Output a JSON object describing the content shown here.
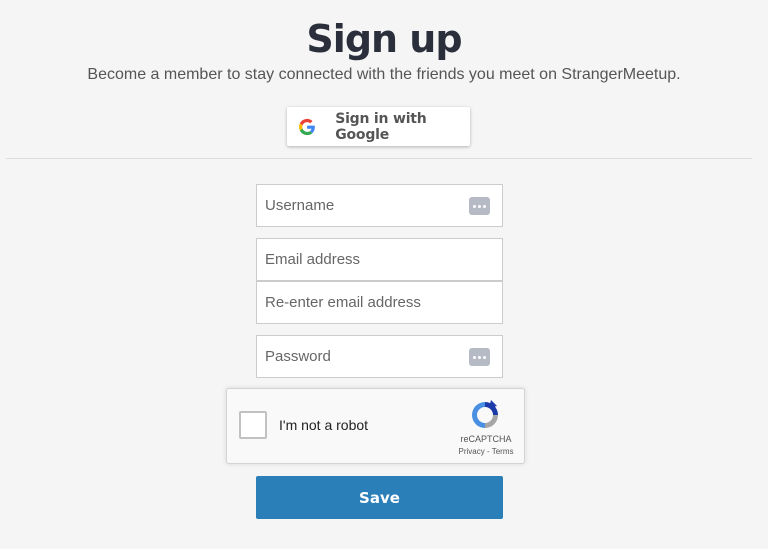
{
  "header": {
    "title": "Sign up",
    "subtitle": "Become a member to stay connected with the friends you meet on StrangerMeetup."
  },
  "google": {
    "label": "Sign in with Google",
    "icon": "google-g-icon"
  },
  "form": {
    "username": {
      "placeholder": "Username",
      "value": ""
    },
    "email": {
      "placeholder": "Email address",
      "value": ""
    },
    "email_confirm": {
      "placeholder": "Re-enter email address",
      "value": ""
    },
    "password": {
      "placeholder": "Password",
      "value": ""
    },
    "password_manager_icon": "password-manager-icon"
  },
  "recaptcha": {
    "label": "I'm not a robot",
    "brand": "reCAPTCHA",
    "privacy": "Privacy",
    "separator": " - ",
    "terms": "Terms",
    "checked": false
  },
  "save_button": {
    "label": "Save"
  },
  "colors": {
    "primary": "#2a7fb8",
    "title": "#2a2f3b",
    "background": "#f5f5f5"
  }
}
